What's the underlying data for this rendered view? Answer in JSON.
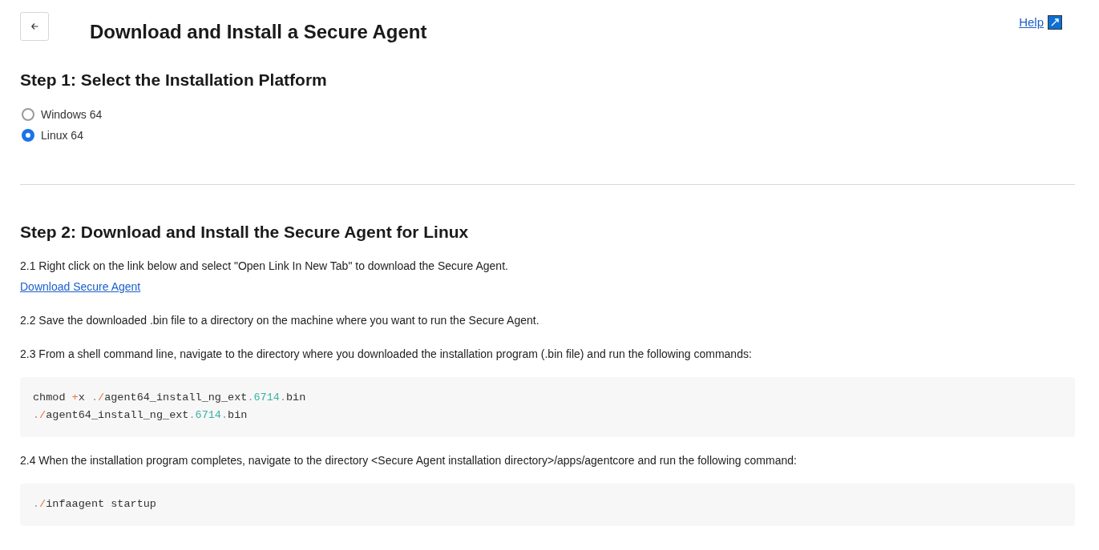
{
  "title": "Download and Install a Secure Agent",
  "help_link": "Help",
  "step1": {
    "heading": "Step 1: Select the Installation Platform",
    "options": [
      {
        "label": "Windows 64",
        "selected": false
      },
      {
        "label": "Linux 64",
        "selected": true
      }
    ]
  },
  "step2": {
    "heading": "Step 2: Download and Install the Secure Agent for Linux",
    "blocks": [
      {
        "kind": "instruction",
        "text": "2.1 Right click on the link below and select \"Open Link In New Tab\" to download the Secure Agent.",
        "link": "Download Secure Agent"
      },
      {
        "kind": "instruction",
        "text": "2.2 Save the downloaded .bin file to a directory on the machine where you want to run the Secure Agent."
      },
      {
        "kind": "instruction",
        "text": "2.3 From a shell command line, navigate to the directory where you downloaded the installation program (.bin file) and run the following commands:"
      },
      {
        "kind": "code",
        "lines": [
          [
            {
              "kind": "text",
              "text": "chmod "
            },
            {
              "kind": "operator",
              "text": "+"
            },
            {
              "kind": "text",
              "text": "x "
            },
            {
              "kind": "punct",
              "text": "."
            },
            {
              "kind": "operator",
              "text": "/"
            },
            {
              "kind": "text",
              "text": "agent64_install_ng_ext"
            },
            {
              "kind": "punct",
              "text": "."
            },
            {
              "kind": "number",
              "text": "6714"
            },
            {
              "kind": "punct",
              "text": "."
            },
            {
              "kind": "text",
              "text": "bin"
            }
          ],
          [
            {
              "kind": "punct",
              "text": "."
            },
            {
              "kind": "operator",
              "text": "/"
            },
            {
              "kind": "text",
              "text": "agent64_install_ng_ext"
            },
            {
              "kind": "punct",
              "text": "."
            },
            {
              "kind": "number",
              "text": "6714"
            },
            {
              "kind": "punct",
              "text": "."
            },
            {
              "kind": "text",
              "text": "bin"
            }
          ]
        ]
      },
      {
        "kind": "instruction",
        "text": "2.4 When the installation program completes, navigate to the directory <Secure Agent installation directory>/apps/agentcore and run the following command:"
      },
      {
        "kind": "code",
        "lines": [
          [
            {
              "kind": "punct",
              "text": "."
            },
            {
              "kind": "operator",
              "text": "/"
            },
            {
              "kind": "text",
              "text": "infaagent startup"
            }
          ]
        ]
      }
    ]
  }
}
